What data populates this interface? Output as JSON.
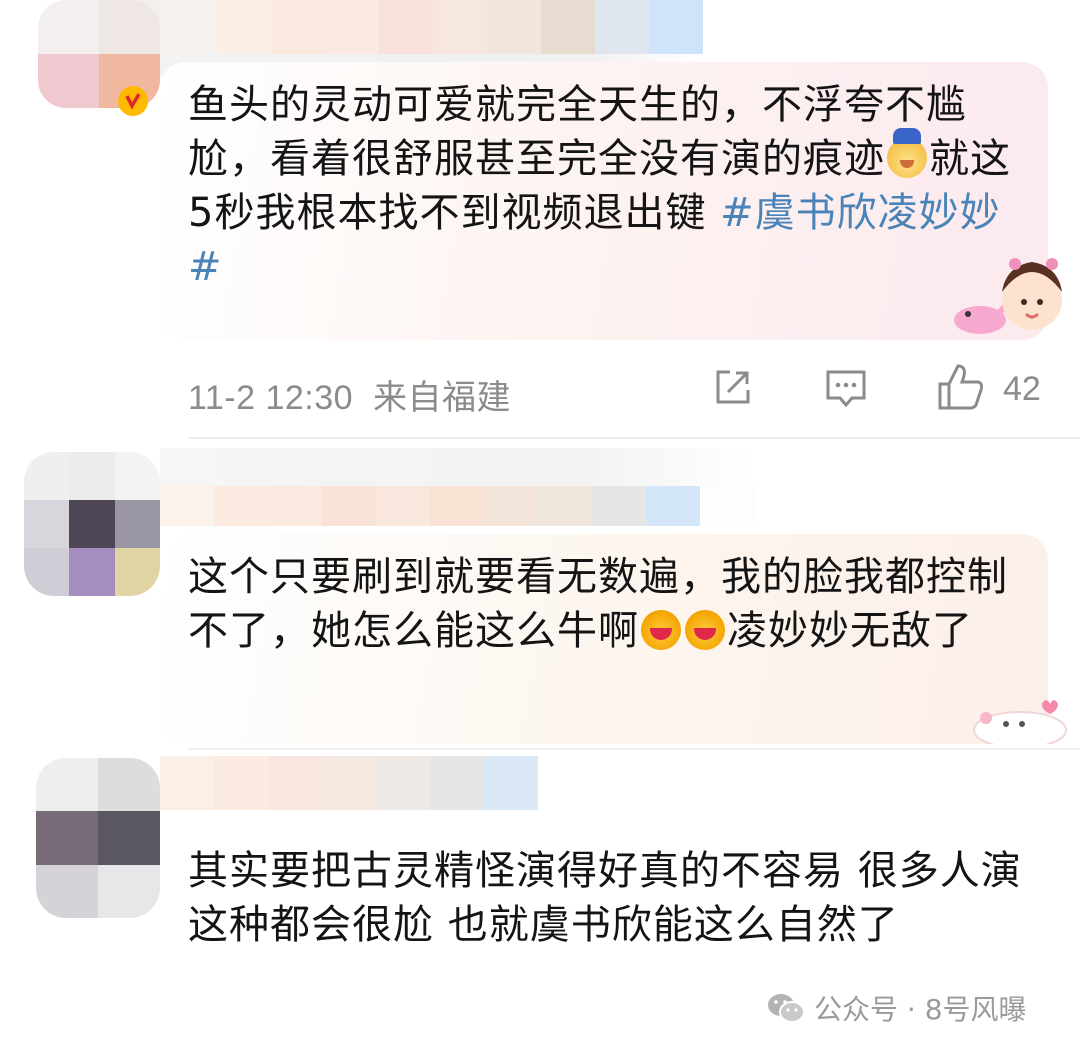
{
  "comments": [
    {
      "text_main": "鱼头的灵动可爱就完全天生的，不浮夸不尴尬，看着很舒服甚至完全没有演的痕迹",
      "text_after_emoji": "就这5秒我根本找不到视频退出键 ",
      "hashtag": "#虞书欣凌妙妙#",
      "emoji_name": "star-face-emoji",
      "time": "11-2 12:30",
      "location": "来自福建",
      "like_count": "42",
      "icons": [
        "share-icon",
        "comment-icon",
        "like-icon"
      ]
    },
    {
      "text_before_emoji": "这个只要刷到就要看无数遍，我的脸我都控制不了，她怎么能这么牛啊",
      "text_after_emoji": "凌妙妙无敌了",
      "emoji_name": "hug-face-emoji"
    },
    {
      "text_main": "其实要把古灵精怪演得好真的不容易 很多人演这种都会很尬 也就虞书欣能这么自然了"
    }
  ],
  "watermark": {
    "text": "公众号 · 8号风曝",
    "icon": "wechat-icon"
  },
  "colors": {
    "hashtag": "#4a83b8",
    "meta_text": "#8b8b8b",
    "bubble_pink": "#fbe9ee",
    "bubble_peach": "#fcefe9"
  }
}
